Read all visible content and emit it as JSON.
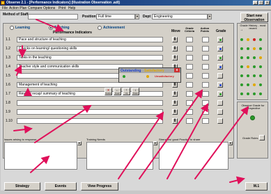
{
  "window": {
    "title": "Observe 2.1 - [Performance Indicators] (Illustration Observation .adt)",
    "controls": [
      "_",
      "□",
      "x"
    ]
  },
  "menu": [
    "File",
    "Action Plan",
    "Compare",
    "Options",
    "Print",
    "Help"
  ],
  "header": {
    "method_label": "Method of Staff",
    "position_label": "Position",
    "position_value": "Full time",
    "dept_label": "Dept",
    "dept_value": "Engineering",
    "new_obs_label": "Start new Observation"
  },
  "indicators": {
    "radio_learning": "Learning",
    "radio_teaching": "Teaching",
    "radio_achievement": "Achievement",
    "title": "Performance Indicators",
    "col_move": "Move",
    "col_grade_criteria": "Grade Criteria",
    "col_action_points": "Action Points",
    "col_grade": "Grade",
    "rows": [
      {
        "num": "1.1",
        "text": "Pace and structure of teaching"
      },
      {
        "num": "1.2",
        "text": "Checks on learning/ questioning skills"
      },
      {
        "num": "1.3",
        "text": "Tasks in the teaching"
      },
      {
        "num": "1.4",
        "text": "Teacher style and communication skills"
      },
      {
        "num": "1.5",
        "text": ""
      },
      {
        "num": "1.6",
        "text": "Management of teaching"
      },
      {
        "num": "1.7",
        "text": "Review/ recap/ summary of teaching"
      },
      {
        "num": "1.8",
        "text": ""
      },
      {
        "num": "1.9",
        "text": ""
      },
      {
        "num": "1.10",
        "text": ""
      }
    ],
    "grade_colors": [
      "#1e9a1e",
      "#1a40d0",
      "#1e9a1e",
      "#1a40d0",
      "",
      "#1a40d0",
      "#1e9a1e",
      "",
      "",
      ""
    ]
  },
  "popup": {
    "outstanding": "Outstanding",
    "satisfactory": "Satisfactory",
    "unsatisfactory": "Unsatisfactory",
    "close": "x",
    "colors": {
      "outstanding": "#2aa02a",
      "satisfactory": "#e0a800",
      "unsatisfactory": "#d02020"
    }
  },
  "toolbar": {
    "items": [
      {
        "icon": "x",
        "label": "Delete",
        "color": "#c00000"
      },
      {
        "icon": "←",
        "label": "Insert",
        "color": "#000000"
      },
      {
        "icon": "↑",
        "label": "Up",
        "color": "#000000"
      },
      {
        "icon": "↓",
        "label": "Down",
        "color": "#000000"
      }
    ]
  },
  "history": {
    "title": "Grade History - most recent",
    "arrow": "→",
    "dots": [
      [
        "#2a9a2a",
        "#e0a800",
        "#d02020",
        "#2a9a2a"
      ],
      [
        "#2a9a2a",
        "#2a9a2a",
        "#e0a800",
        "#2a9a2a"
      ],
      [
        "#2a9a2a",
        "#2a9a2a",
        "#2a9a2a",
        "#e0a800"
      ],
      [
        "#2a9a2a",
        "#e0a800",
        "#2a9a2a",
        "#2a9a2a"
      ],
      [
        "#2a9a2a",
        "#2a9a2a",
        "#2a9a2a",
        "#2a9a2a"
      ],
      [
        "#2a9a2a",
        "#2a9a2a",
        "#e0a800",
        "#2a9a2a"
      ],
      [
        "#2a9a2a",
        "#2a9a2a",
        "#2a9a2a",
        "#2a9a2a"
      ]
    ]
  },
  "bottom_panels": {
    "issues": "Issues arising to response",
    "training": "Training Needs",
    "practice": "Strengths/ good Practice to share",
    "overall_title": "Observe Grade for Perspective",
    "grade_rules": "Grade Rules"
  },
  "footer": {
    "btn_strategy": "Strategy",
    "btn_events": "Events",
    "btn_view_progress": "View Progress",
    "btn_close": "M.1"
  },
  "accent": {
    "arrow": "#e0105a",
    "title_bar": "#0a246a"
  }
}
